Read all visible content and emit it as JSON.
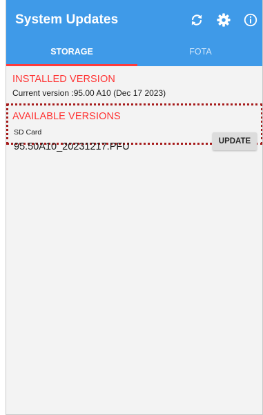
{
  "appbar": {
    "title": "System Updates",
    "actions": [
      {
        "icon": "refresh-icon"
      },
      {
        "icon": "gear-icon"
      },
      {
        "icon": "info-icon"
      }
    ]
  },
  "tabs": [
    {
      "label": "STORAGE",
      "selected": true
    },
    {
      "label": "FOTA",
      "selected": false
    }
  ],
  "installed": {
    "heading": "INSTALLED VERSION",
    "current_version": "Current version :95.00 A10 (Dec 17 2023)"
  },
  "available": {
    "heading": "AVAILABLE VERSIONS",
    "items": [
      {
        "source": "SD Card",
        "file": "95.50A10_20231217.PFU",
        "action_label": "UPDATE"
      }
    ]
  },
  "colors": {
    "primary": "#3f9ae8",
    "accent": "#ff3232",
    "highlight_border": "#a61b1b",
    "background": "#f3f3f3"
  }
}
